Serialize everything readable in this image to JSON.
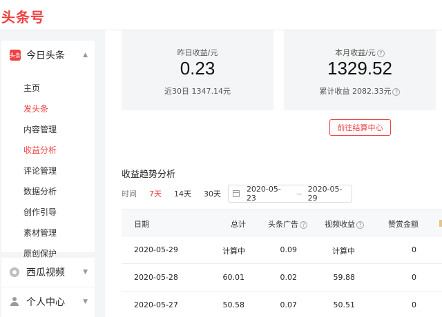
{
  "app": {
    "logo": "头条号",
    "brand_color": "#f04142"
  },
  "sidebar": {
    "main_section": {
      "icon_text": "头条",
      "title": "今日头条",
      "items": [
        {
          "label": "主页",
          "active": false
        },
        {
          "label": "发头条",
          "active": true
        },
        {
          "label": "内容管理",
          "active": false
        },
        {
          "label": "收益分析",
          "active": true
        },
        {
          "label": "评论管理",
          "active": false
        },
        {
          "label": "数据分析",
          "active": false
        },
        {
          "label": "创作引导",
          "active": false
        },
        {
          "label": "素材管理",
          "active": false
        },
        {
          "label": "原创保护",
          "active": false
        }
      ]
    },
    "xigua": {
      "title": "西瓜视频"
    },
    "personal": {
      "title": "个人中心"
    }
  },
  "stats": {
    "yesterday": {
      "label": "昨日收益/元",
      "value": "0.23",
      "sub": "近30日 1347.14元"
    },
    "month": {
      "label": "本月收益/元",
      "value": "1329.52",
      "sub": "累计收益 2082.33元"
    },
    "help_glyph": "?"
  },
  "settle_button": "前往结算中心",
  "trend": {
    "title": "收益趋势分析",
    "time_label": "时间",
    "options": [
      {
        "label": "7天",
        "active": true
      },
      {
        "label": "14天",
        "active": false
      },
      {
        "label": "30天",
        "active": false
      }
    ],
    "date_start": "2020-05-23",
    "date_sep": "~",
    "date_end": "2020-05-29"
  },
  "table": {
    "headers": {
      "date": "日期",
      "total": "总计",
      "ad": "头条广告",
      "video": "视频收益",
      "tip": "赞赏金额"
    },
    "rows": [
      {
        "date": "2020-05-29",
        "total": "计算中",
        "ad": "0.09",
        "video": "计算中",
        "tip": "0"
      },
      {
        "date": "2020-05-28",
        "total": "60.01",
        "ad": "0.02",
        "video": "59.88",
        "tip": "0"
      },
      {
        "date": "2020-05-27",
        "total": "50.58",
        "ad": "0.07",
        "video": "50.51",
        "tip": "0"
      }
    ]
  }
}
